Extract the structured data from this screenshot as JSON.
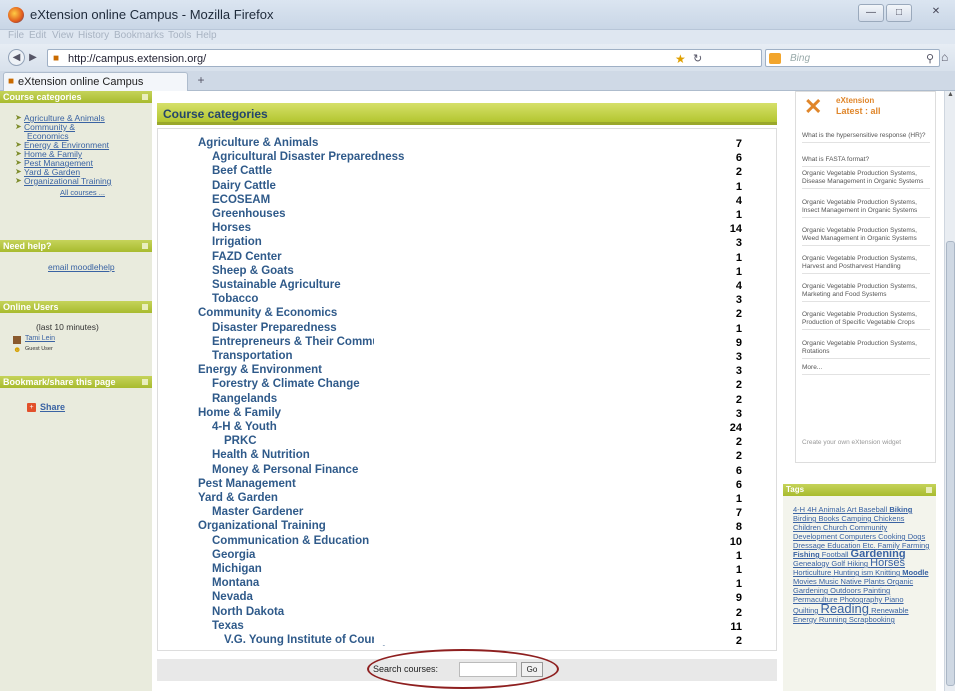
{
  "window": {
    "title": "eXtension online Campus - Mozilla Firefox"
  },
  "menu": [
    "File",
    "Edit",
    "View",
    "History",
    "Bookmarks",
    "Tools",
    "Help"
  ],
  "nav": {
    "url": "http://campus.extension.org/",
    "search_placeholder": "Bing"
  },
  "tab": {
    "title": "eXtension online Campus",
    "new_tab": "+"
  },
  "left": {
    "categories_title": "Course categories",
    "categories": [
      "Agriculture & Animals",
      "Community &",
      "Economics",
      "Energy & Environment",
      "Home & Family",
      "Pest Management",
      "Yard & Garden",
      "Organizational Training"
    ],
    "all_courses": "All courses ...",
    "help_title": "Need help?",
    "help_link": "email moodlehelp",
    "online_title": "Online Users",
    "online_window": "(last 10 minutes)",
    "users": [
      "Tami Lein",
      "Guest User"
    ],
    "bookmark_title": "Bookmark/share this page",
    "share": "Share"
  },
  "main": {
    "title": "Course categories",
    "rows": [
      {
        "name": "Agriculture & Animals",
        "count": "7",
        "level": 0
      },
      {
        "name": "Agricultural Disaster Preparedness",
        "count": "6",
        "level": 1
      },
      {
        "name": "Beef Cattle",
        "count": "2",
        "level": 1
      },
      {
        "name": "Dairy Cattle",
        "count": "1",
        "level": 1
      },
      {
        "name": "ECOSEAM",
        "count": "4",
        "level": 1
      },
      {
        "name": "Greenhouses",
        "count": "1",
        "level": 1
      },
      {
        "name": "Horses",
        "count": "14",
        "level": 1
      },
      {
        "name": "Irrigation",
        "count": "3",
        "level": 1
      },
      {
        "name": "FAZD Center",
        "count": "1",
        "level": 1
      },
      {
        "name": "Sheep & Goats",
        "count": "1",
        "level": 1
      },
      {
        "name": "Sustainable Agriculture",
        "count": "4",
        "level": 1
      },
      {
        "name": "Tobacco",
        "count": "3",
        "level": 1
      },
      {
        "name": "Community & Economics",
        "count": "2",
        "level": 0
      },
      {
        "name": "Disaster Preparedness",
        "count": "1",
        "level": 1
      },
      {
        "name": "Entrepreneurs & Their Communities",
        "count": "9",
        "level": 1
      },
      {
        "name": "Transportation",
        "count": "3",
        "level": 1
      },
      {
        "name": "Energy & Environment",
        "count": "3",
        "level": 0
      },
      {
        "name": "Forestry & Climate Change",
        "count": "2",
        "level": 1
      },
      {
        "name": "Rangelands",
        "count": "2",
        "level": 1
      },
      {
        "name": "Home & Family",
        "count": "3",
        "level": 0
      },
      {
        "name": "4-H & Youth",
        "count": "24",
        "level": 1
      },
      {
        "name": "PRKC",
        "count": "2",
        "level": 2
      },
      {
        "name": "Health & Nutrition",
        "count": "2",
        "level": 1
      },
      {
        "name": "Money & Personal Finance",
        "count": "6",
        "level": 1
      },
      {
        "name": "Pest Management",
        "count": "6",
        "level": 0
      },
      {
        "name": "Yard & Garden",
        "count": "1",
        "level": 0
      },
      {
        "name": "Master Gardener",
        "count": "7",
        "level": 1
      },
      {
        "name": "Organizational Training",
        "count": "8",
        "level": 0
      },
      {
        "name": "Communication & Education",
        "count": "10",
        "level": 1
      },
      {
        "name": "Georgia",
        "count": "1",
        "level": 1
      },
      {
        "name": "Michigan",
        "count": "1",
        "level": 1
      },
      {
        "name": "Montana",
        "count": "1",
        "level": 1
      },
      {
        "name": "Nevada",
        "count": "9",
        "level": 1
      },
      {
        "name": "North Dakota",
        "count": "2",
        "level": 1
      },
      {
        "name": "Texas",
        "count": "11",
        "level": 1
      },
      {
        "name": "V.G. Young Institute of County Government",
        "count": "2",
        "level": 2
      }
    ],
    "search_label": "Search courses:",
    "search_button": "Go"
  },
  "right": {
    "brand": "eXtension",
    "latest": "Latest : all",
    "questions": [
      "What is the hypersensitive response (HR)?",
      "What is FASTA format?",
      "Organic Vegetable Production Systems, Disease Management in Organic Systems",
      "Organic Vegetable Production Systems, Insect Management in Organic Systems",
      "Organic Vegetable Production Systems, Weed Management in Organic Systems",
      "Organic Vegetable Production Systems, Harvest and Postharvest Handling",
      "Organic Vegetable Production Systems, Marketing and Food Systems",
      "Organic Vegetable Production Systems, Production of Specific Vegetable Crops",
      "Organic Vegetable Production Systems, Rotations",
      "More..."
    ],
    "create_widget": "Create your own eXtension widget",
    "tags_title": "Tags",
    "tags": [
      "4-H",
      "4H",
      "Animals",
      "Art",
      "Baseball",
      "Biking",
      "Birding",
      "Books",
      "Camping",
      "Chickens",
      "Children",
      "Church",
      "Community Development",
      "Computers",
      "Cooking",
      "Dogs",
      "Dressage",
      "Education",
      "Etc.",
      "Family",
      "Farming",
      "Fishing",
      "Football",
      "Gardening",
      "Genealogy",
      "Golf",
      "Hiking",
      "Horses",
      "Horticulture",
      "Hunting",
      "ism",
      "Knitting",
      "Moodle",
      "Movies",
      "Music",
      "Native Plants",
      "Organic Gardening",
      "Outdoors",
      "Painting",
      "Permaculture",
      "Photography",
      "Piano",
      "Quilting",
      "Reading",
      "Renewable",
      "Energy",
      "Running",
      "Scrapbooking"
    ]
  }
}
